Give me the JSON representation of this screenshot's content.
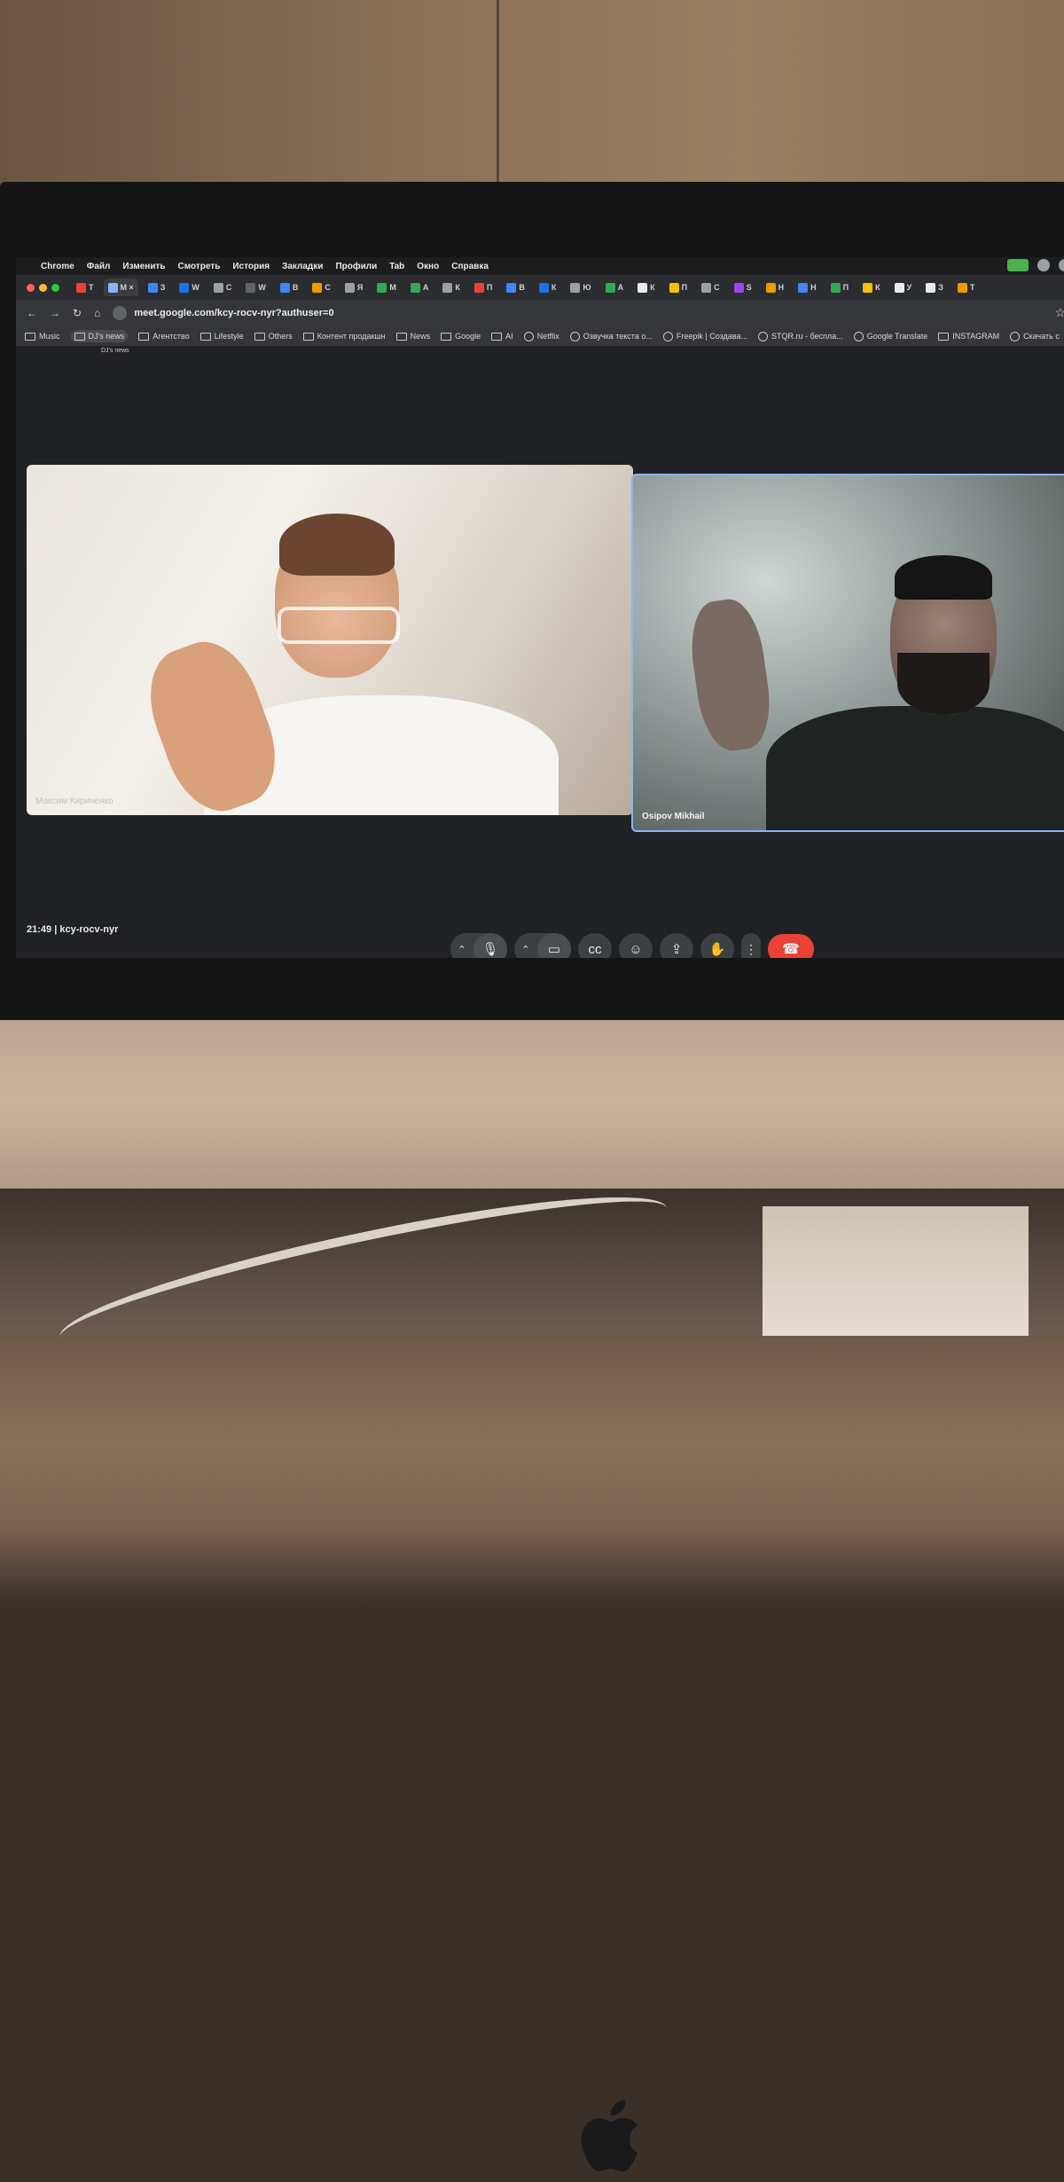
{
  "menubar": {
    "items": [
      "Chrome",
      "Файл",
      "Изменить",
      "Смотреть",
      "История",
      "Закладки",
      "Профили",
      "Tab",
      "Окно",
      "Справка"
    ]
  },
  "tabs": [
    {
      "label": "T",
      "color": "#ea4335"
    },
    {
      "label": "M ×",
      "color": "#8ab4f8",
      "active": true
    },
    {
      "label": "З",
      "color": "#4285f4"
    },
    {
      "label": "W",
      "color": "#1a73e8"
    },
    {
      "label": "С",
      "color": "#9aa0a6"
    },
    {
      "label": "W",
      "color": "#5f6368"
    },
    {
      "label": "В",
      "color": "#4285f4"
    },
    {
      "label": "С",
      "color": "#f29900"
    },
    {
      "label": "Я",
      "color": "#9aa0a6"
    },
    {
      "label": "М",
      "color": "#34a853"
    },
    {
      "label": "А",
      "color": "#34a853"
    },
    {
      "label": "К",
      "color": "#9aa0a6"
    },
    {
      "label": "П",
      "color": "#ea4335"
    },
    {
      "label": "В",
      "color": "#4285f4"
    },
    {
      "label": "К",
      "color": "#1a73e8"
    },
    {
      "label": "Ю",
      "color": "#9aa0a6"
    },
    {
      "label": "А",
      "color": "#34a853"
    },
    {
      "label": "К",
      "color": "#e8eaed"
    },
    {
      "label": "П",
      "color": "#fbbc04"
    },
    {
      "label": "С",
      "color": "#9aa0a6"
    },
    {
      "label": "S",
      "color": "#a142f4"
    },
    {
      "label": "Н",
      "color": "#f29900"
    },
    {
      "label": "Н",
      "color": "#4285f4"
    },
    {
      "label": "П",
      "color": "#34a853"
    },
    {
      "label": "К",
      "color": "#fbbc04"
    },
    {
      "label": "У",
      "color": "#e8eaed"
    },
    {
      "label": "З",
      "color": "#e8eaed"
    },
    {
      "label": "Т",
      "color": "#f29900"
    }
  ],
  "toolbar": {
    "url": "meet.google.com/kcy-rocv-nyr?authuser=0"
  },
  "bookmarks": [
    {
      "label": "Music",
      "icon": "folder-icon"
    },
    {
      "label": "DJ's news",
      "icon": "folder-icon",
      "hover": true
    },
    {
      "label": "Агентство",
      "icon": "folder-icon"
    },
    {
      "label": "Lifestyle",
      "icon": "folder-icon"
    },
    {
      "label": "Others",
      "icon": "folder-icon"
    },
    {
      "label": "Контент продакшн",
      "icon": "folder-icon"
    },
    {
      "label": "News",
      "icon": "folder-icon"
    },
    {
      "label": "Google",
      "icon": "folder-icon"
    },
    {
      "label": "AI",
      "icon": "folder-icon"
    },
    {
      "label": "Netflix",
      "icon": "netflix-icon"
    },
    {
      "label": "Озвучка текста о...",
      "icon": "speech-icon"
    },
    {
      "label": "Freepik | Создава...",
      "icon": "freepik-icon"
    },
    {
      "label": "STQR.ru - бесплa...",
      "icon": "stqr-icon"
    },
    {
      "label": "Google Translate",
      "icon": "translate-icon"
    },
    {
      "label": "INSTAGRAM",
      "icon": "folder-icon"
    },
    {
      "label": "Скачать с",
      "icon": "download-icon"
    }
  ],
  "tooltip": "DJ's news",
  "participants": [
    {
      "name": "Максим Кириченко"
    },
    {
      "name": "Osipov Mikhail"
    }
  ],
  "meeting": {
    "time": "21:49",
    "separator": "|",
    "code": "kcy-rocv-nyr"
  },
  "colors": {
    "meet_end": "#ea4335",
    "speaker_border": "#8ab4f8"
  }
}
